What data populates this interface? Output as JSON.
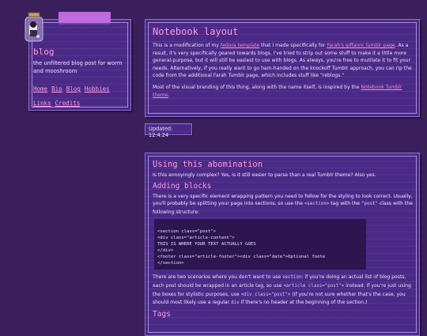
{
  "sidebar": {
    "blog_title": "blog",
    "description": "the unfiltered blog post for worm and mooshroom",
    "nav": [
      "Home",
      "Bio",
      "Blog",
      "Hobbies",
      "Links",
      "Credits"
    ]
  },
  "updated": "Updated: 12.4.24",
  "post1": {
    "title": "Notebook layout",
    "p1_a": "This is a modification of my ",
    "p1_link1": "fedora template",
    "p1_b": " that I made specifically for ",
    "p1_link2": "Farah's giffanni Tumblr page",
    "p1_c": ". As a result, it's very specifically geared towards blogs. I've tried to strip out some stuff to make it a little more general-purpose, but it will still be easiest to use with blogs. As always, you're free to mutilate it to fit your needs. Alternatively, if you really want to go ham-handed on the knockoff Tumblr approach, you can rip the code from the additional Farah Tumblr page, which includes stuff like \"reblogs.\"",
    "p2_a": "Most of the visual branding of this thing, along with the name itself, is inspired by the ",
    "p2_link": "Notebook Tumblr theme",
    "p2_b": "."
  },
  "post2": {
    "title": "Using this abomination",
    "intro": "Is this annoyingly complex? Yes, is it still easier to parse than a real Tumblr theme? Also yes.",
    "sub1": "Adding blocks",
    "p1_a": "There is a very specific element wrapping pattern you need to follow for the styling to look correct. Usually, you'll probably be splitting your page into sections, so use the ",
    "p1_code1": "<section>",
    "p1_b": " tag with the ",
    "p1_code2": "\"post\"",
    "p1_c": " class with the following structure:",
    "code_lines": [
      "<section class=\"post\">",
      "<div class=\"article-content\">",
      "THIS IS WHERE YOUR TEXT ACTUALLY GOES",
      "</div>",
      "<footer class=\"article-footer\"><div class=\"date\">Optional foote",
      "</section>"
    ],
    "p2_a": "There are two scenarios where you don't want to use ",
    "p2_code1": "section",
    "p2_b": ": if you're doing an actual list of blog posts, each post should be wrapped in an article tag, so use ",
    "p2_code2": "<article class=\"post\">",
    "p2_c": " instead. If you're just using the boxes for stylistic purposes, use ",
    "p2_code3": "<div class=\"post\">",
    "p2_d": " (If you're not sure whether that's the case, you should most likely use a regular ",
    "p2_code4": "div",
    "p2_e": " if there's no header at the beginning of the section.)",
    "sub2": "Tags"
  }
}
